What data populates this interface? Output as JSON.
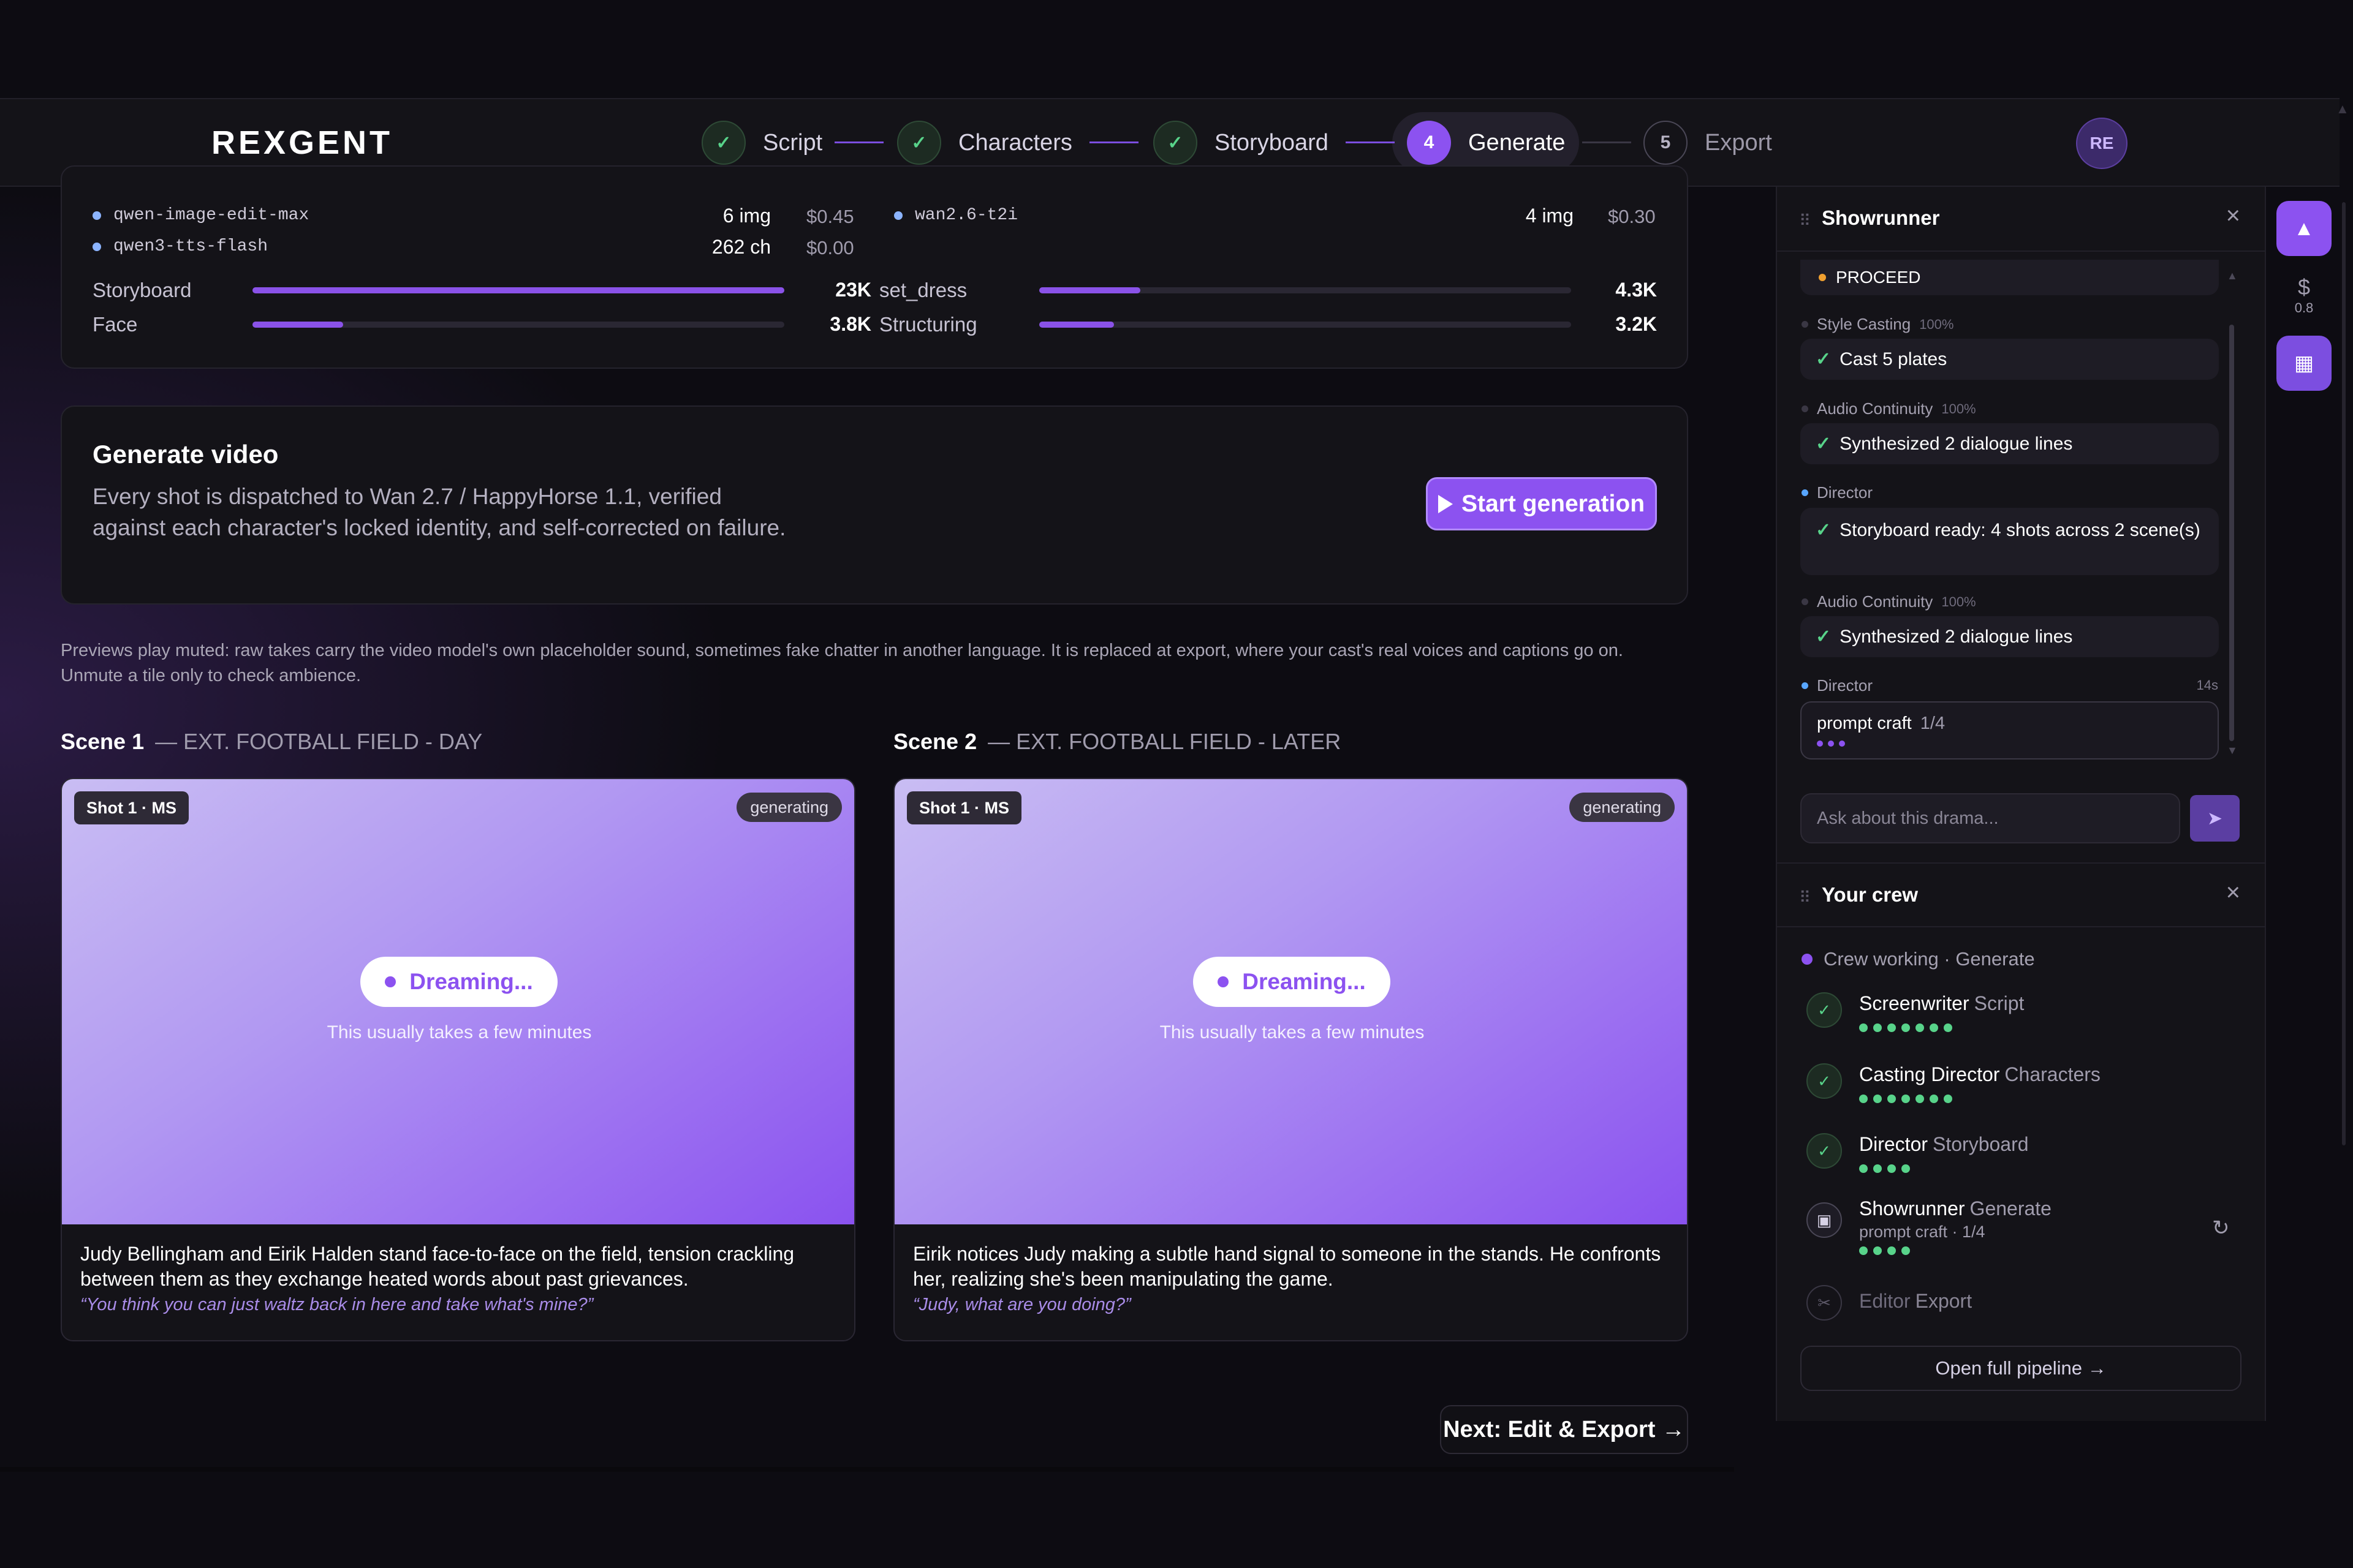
{
  "app": {
    "logo": "REXGENT",
    "avatar": "RE"
  },
  "steps": [
    {
      "num": "",
      "label": "Script",
      "state": "done"
    },
    {
      "num": "",
      "label": "Characters",
      "state": "done"
    },
    {
      "num": "",
      "label": "Storyboard",
      "state": "done"
    },
    {
      "num": "4",
      "label": "Generate",
      "state": "active"
    },
    {
      "num": "5",
      "label": "Export",
      "state": "todo"
    }
  ],
  "usage": {
    "models": [
      {
        "name": "qwen-image-edit-max",
        "amount": "6 img",
        "cost": "$0.45"
      },
      {
        "name": "wan2.6-t2i",
        "amount": "4 img",
        "cost": "$0.30"
      },
      {
        "name": "qwen3-tts-flash",
        "amount": "262 ch",
        "cost": "$0.00"
      }
    ],
    "bars": [
      {
        "label": "Storyboard",
        "value": "23K",
        "fraction": 1.0
      },
      {
        "label": "set_dress",
        "value": "4.3K",
        "fraction": 0.19
      },
      {
        "label": "Face",
        "value": "3.8K",
        "fraction": 0.17
      },
      {
        "label": "Structuring",
        "value": "3.2K",
        "fraction": 0.14
      }
    ]
  },
  "generate": {
    "title": "Generate video",
    "description": "Every shot is dispatched to Wan 2.7 / HappyHorse 1.1, verified against each character's locked identity, and self-corrected on failure.",
    "button": "Start generation"
  },
  "notice": "Previews play muted: raw takes carry the video model's own placeholder sound, sometimes fake chatter in another language. It is replaced at export, where your cast's real voices and captions go on. Unmute a tile only to check ambience.",
  "scenes": [
    {
      "title": "Scene 1",
      "location": "— EXT. FOOTBALL FIELD - DAY",
      "shot": "Shot 1 · MS",
      "status": "generating",
      "dream": "Dreaming...",
      "dream_sub": "This usually takes a few minutes",
      "description": "Judy Bellingham and Eirik Halden stand face-to-face on the field, tension crackling between them as they exchange heated words about past grievances.",
      "quote": "“You think you can just waltz back in here and take what's mine?”"
    },
    {
      "title": "Scene 2",
      "location": "— EXT. FOOTBALL FIELD - LATER",
      "shot": "Shot 1 · MS",
      "status": "generating",
      "dream": "Dreaming...",
      "dream_sub": "This usually takes a few minutes",
      "description": "Eirik notices Judy making a subtle hand signal to someone in the stands. He confronts her, realizing she's been manipulating the game.",
      "quote": "“Judy, what are you doing?”"
    }
  ],
  "next_button": "Next: Edit & Export →",
  "showrunner": {
    "title": "Showrunner",
    "proceed": "PROCEED",
    "messages": [
      {
        "agent": "Style Casting",
        "pct": "100%",
        "text": "Cast 5 plates"
      },
      {
        "agent": "Audio Continuity",
        "pct": "100%",
        "text": "Synthesized 2 dialogue lines"
      },
      {
        "agent": "Director",
        "pct": "",
        "text": "Storyboard ready: 4 shots across 2 scene(s)"
      },
      {
        "agent": "Audio Continuity",
        "pct": "100%",
        "text": "Synthesized 2 dialogue lines"
      }
    ],
    "current": {
      "agent": "Director",
      "time": "14s",
      "task": "prompt craft",
      "progress": "1/4"
    },
    "ask_placeholder": "Ask about this drama..."
  },
  "crew": {
    "title": "Your crew",
    "status": "Crew working · Generate",
    "members": [
      {
        "name": "Screenwriter",
        "stage": "Script",
        "sub": "",
        "dots": 7,
        "state": "done"
      },
      {
        "name": "Casting Director",
        "stage": "Characters",
        "sub": "",
        "dots": 7,
        "state": "done"
      },
      {
        "name": "Director",
        "stage": "Storyboard",
        "sub": "",
        "dots": 4,
        "state": "done"
      },
      {
        "name": "Showrunner",
        "stage": "Generate",
        "sub": "prompt craft · 1/4",
        "dots": 4,
        "state": "running"
      },
      {
        "name": "Editor",
        "stage": "Export",
        "sub": "",
        "dots": 0,
        "state": "idle"
      }
    ],
    "pipeline_button": "Open full pipeline →"
  },
  "rail": {
    "cost_symbol": "$",
    "cost_value": "0.8"
  },
  "colors": {
    "accent": "#8c52f0",
    "success": "#58d38a",
    "background": "#0d0c12",
    "panel": "#141318"
  }
}
